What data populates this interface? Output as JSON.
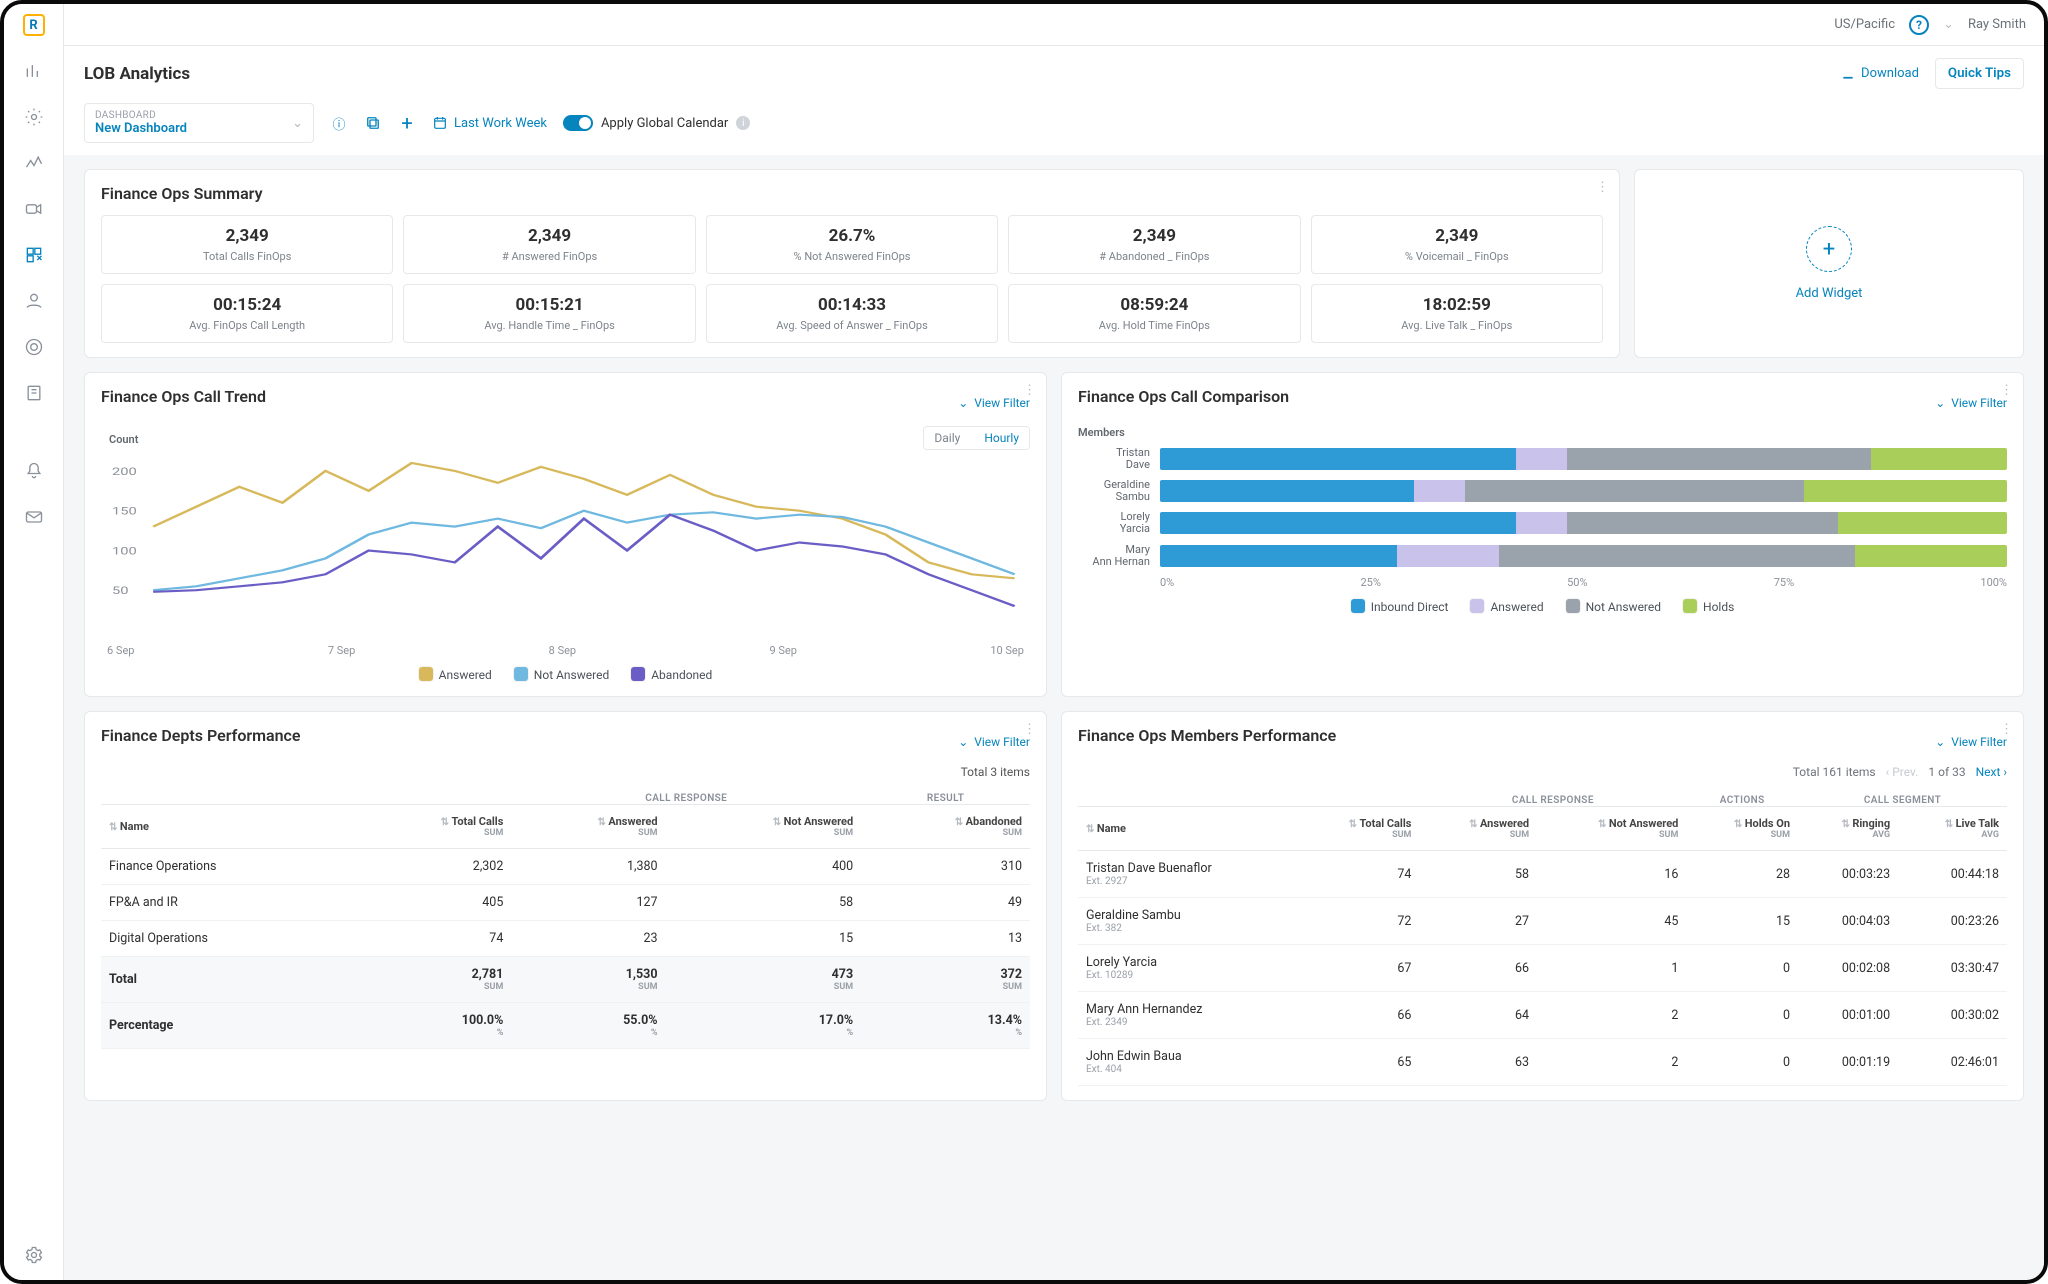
{
  "topbar": {
    "timezone": "US/Pacific",
    "user": "Ray Smith"
  },
  "page_title": "LOB Analytics",
  "download": "Download",
  "quick_tips": "Quick Tips",
  "dash_label": "DASHBOARD",
  "dash_name": "New Dashboard",
  "last_work_week": "Last Work Week",
  "global_calendar": "Apply Global Calendar",
  "summary": {
    "title": "Finance Ops Summary",
    "kpis": [
      {
        "v": "2,349",
        "l": "Total Calls FinOps"
      },
      {
        "v": "2,349",
        "l": "# Answered FinOps"
      },
      {
        "v": "26.7%",
        "l": "% Not Answered FinOps"
      },
      {
        "v": "2,349",
        "l": "# Abandoned _ FinOps"
      },
      {
        "v": "2,349",
        "l": "% Voicemail _ FinOps"
      },
      {
        "v": "00:15:24",
        "l": "Avg. FinOps Call Length"
      },
      {
        "v": "00:15:21",
        "l": "Avg. Handle Time _ FinOps"
      },
      {
        "v": "00:14:33",
        "l": "Avg. Speed of Answer _ FinOps"
      },
      {
        "v": "08:59:24",
        "l": "Avg. Hold Time FinOps"
      },
      {
        "v": "18:02:59",
        "l": "Avg. Live Talk _ FinOps"
      }
    ]
  },
  "add_widget": "Add Widget",
  "trend": {
    "title": "Finance Ops Call Trend",
    "view_filter": "View Filter",
    "count": "Count",
    "daily": "Daily",
    "hourly": "Hourly",
    "x": [
      "6 Sep",
      "7 Sep",
      "8 Sep",
      "9 Sep",
      "10 Sep"
    ],
    "legend": [
      "Answered",
      "Not Answered",
      "Abandoned"
    ]
  },
  "compare": {
    "title": "Finance Ops Call Comparison",
    "view_filter": "View Filter",
    "members_label": "Members",
    "x": [
      "0%",
      "25%",
      "50%",
      "75%",
      "100%"
    ],
    "legend": [
      "Inbound Direct",
      "Answered",
      "Not Answered",
      "Holds"
    ]
  },
  "dept": {
    "title": "Finance Depts Performance",
    "total_items": "Total 3 items",
    "cols": {
      "name": "Name",
      "total": "Total Calls",
      "answered": "Answered",
      "not": "Not Answered",
      "aband": "Abandoned",
      "sum": "SUM",
      "pct": "%",
      "grp1": "CALL RESPONSE",
      "grp2": "RESULT"
    },
    "rows": [
      {
        "name": "Finance Operations",
        "total": "2,302",
        "answered": "1,380",
        "not": "400",
        "aband": "310"
      },
      {
        "name": "FP&A and IR",
        "total": "405",
        "answered": "127",
        "not": "58",
        "aband": "49"
      },
      {
        "name": "Digital Operations",
        "total": "74",
        "answered": "23",
        "not": "15",
        "aband": "13"
      }
    ],
    "total": {
      "name": "Total",
      "total": "2,781",
      "answered": "1,530",
      "not": "473",
      "aband": "372"
    },
    "pct": {
      "name": "Percentage",
      "total": "100.0%",
      "answered": "55.0%",
      "not": "17.0%",
      "aband": "13.4%"
    }
  },
  "members": {
    "title": "Finance Ops Members Performance",
    "total_items": "Total 161 items",
    "prev": "Prev.",
    "page": "1 of 33",
    "next": "Next",
    "cols": {
      "name": "Name",
      "total": "Total Calls",
      "answered": "Answered",
      "not": "Not Answered",
      "holds": "Holds On",
      "ring": "Ringing",
      "live": "Live Talk",
      "sum": "SUM",
      "avg": "AVG",
      "grp1": "CALL RESPONSE",
      "grp2": "ACTIONS",
      "grp3": "CALL SEGMENT"
    },
    "rows": [
      {
        "name": "Tristan Dave Buenaflor",
        "ext": "Ext. 2927",
        "total": "74",
        "answered": "58",
        "not": "16",
        "holds": "28",
        "ring": "00:03:23",
        "live": "00:44:18"
      },
      {
        "name": "Geraldine Sambu",
        "ext": "Ext. 382",
        "total": "72",
        "answered": "27",
        "not": "45",
        "holds": "15",
        "ring": "00:04:03",
        "live": "00:23:26"
      },
      {
        "name": "Lorely Yarcia",
        "ext": "Ext. 10289",
        "total": "67",
        "answered": "66",
        "not": "1",
        "holds": "0",
        "ring": "00:02:08",
        "live": "03:30:47"
      },
      {
        "name": "Mary Ann Hernandez",
        "ext": "Ext. 2349",
        "total": "66",
        "answered": "64",
        "not": "2",
        "holds": "0",
        "ring": "00:01:00",
        "live": "00:30:02"
      },
      {
        "name": "John Edwin Baua",
        "ext": "Ext. 404",
        "total": "65",
        "answered": "63",
        "not": "2",
        "holds": "0",
        "ring": "00:01:19",
        "live": "02:46:01"
      }
    ]
  },
  "chart_data": [
    {
      "type": "line",
      "title": "Finance Ops Call Trend",
      "ylabel": "Count",
      "ylim": [
        0,
        220
      ],
      "x_range": [
        "6 Sep",
        "10 Sep"
      ],
      "yticks": [
        50,
        100,
        150,
        200
      ],
      "series": [
        {
          "name": "Answered",
          "color": "#d7b95c",
          "values": [
            130,
            155,
            180,
            160,
            200,
            175,
            210,
            200,
            185,
            205,
            190,
            170,
            195,
            170,
            155,
            150,
            140,
            120,
            85,
            70,
            65
          ]
        },
        {
          "name": "Not Answered",
          "color": "#6fb8e0",
          "values": [
            50,
            55,
            65,
            75,
            90,
            120,
            135,
            130,
            140,
            128,
            150,
            135,
            145,
            148,
            140,
            145,
            142,
            130,
            110,
            90,
            70
          ]
        },
        {
          "name": "Abandoned",
          "color": "#6a5dc5",
          "values": [
            48,
            50,
            55,
            60,
            70,
            100,
            95,
            85,
            130,
            90,
            140,
            100,
            145,
            125,
            100,
            110,
            105,
            95,
            70,
            50,
            30
          ]
        }
      ]
    },
    {
      "type": "bar",
      "orientation": "horizontal",
      "stacked": true,
      "unit": "%",
      "xlim": [
        0,
        100
      ],
      "title": "Finance Ops Call Comparison",
      "categories": [
        "Tristan Dave",
        "Geraldine Sambu",
        "Lorely Yarcia",
        "Mary Ann Hernan"
      ],
      "series": [
        {
          "name": "Inbound Direct",
          "color": "#2f9bd6",
          "values": [
            42,
            30,
            42,
            28
          ]
        },
        {
          "name": "Answered",
          "color": "#c9c2eb",
          "values": [
            6,
            6,
            6,
            12
          ]
        },
        {
          "name": "Not Answered",
          "color": "#9aa2ac",
          "values": [
            36,
            40,
            32,
            42
          ]
        },
        {
          "name": "Holds",
          "color": "#a9cf5a",
          "values": [
            16,
            24,
            20,
            18
          ]
        }
      ]
    }
  ]
}
